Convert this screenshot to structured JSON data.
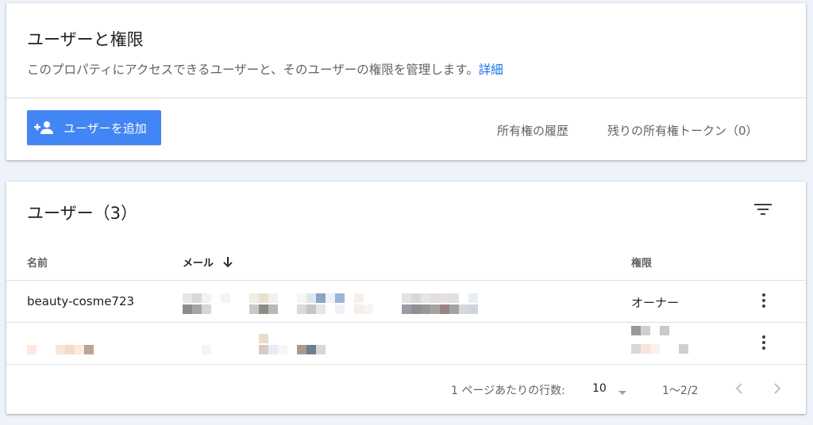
{
  "access": {
    "title": "ユーザーと権限",
    "description": "このプロパティにアクセスできるユーザーと、そのユーザーの権限を管理します。",
    "details_link": "詳細",
    "add_user_label": "ユーザーを追加",
    "history_link": "所有権の履歴",
    "tokens_link": "残りの所有権トークン（0）"
  },
  "users": {
    "title": "ユーザー（3）",
    "columns": {
      "name": "名前",
      "email": "メール",
      "role": "権限"
    },
    "rows": [
      {
        "name": "beauty-cosme723",
        "role": "オーナー"
      }
    ]
  },
  "pagination": {
    "rows_per_page_label": "1 ページあたりの行数:",
    "rows_per_page_value": "10",
    "range": "1〜2/2"
  },
  "colors": {
    "accent": "#4285f4",
    "link": "#1a73e8"
  },
  "icons": [
    "add-person-icon",
    "filter-icon",
    "arrow-down-icon",
    "more-vert-icon",
    "chevron-left-icon",
    "chevron-right-icon",
    "dropdown-caret-icon"
  ]
}
